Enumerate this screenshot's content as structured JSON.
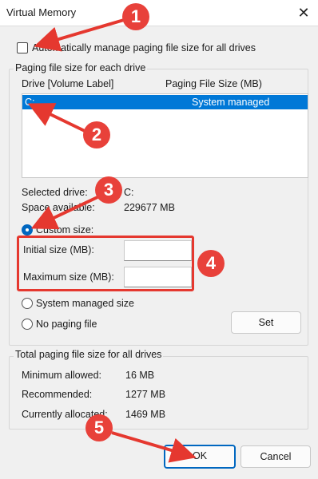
{
  "window": {
    "title": "Virtual Memory"
  },
  "auto_manage": {
    "label": "Automatically manage paging file size for all drives",
    "checked": false
  },
  "each_drive": {
    "group_title": "Paging file size for each drive",
    "col_drive": "Drive  [Volume Label]",
    "col_size": "Paging File Size (MB)",
    "rows": [
      {
        "drive": "C:",
        "size": "System managed"
      }
    ]
  },
  "selected": {
    "drive_label": "Selected drive:",
    "drive_value": "C:",
    "space_label": "Space available:",
    "space_value": "229677 MB"
  },
  "options": {
    "custom": "Custom size:",
    "initial_label": "Initial size (MB):",
    "max_label": "Maximum size (MB):",
    "system_managed": "System managed size",
    "no_paging": "No paging file",
    "set_button": "Set",
    "selected_option": "Custom size:"
  },
  "totals": {
    "group_title": "Total paging file size for all drives",
    "min_label": "Minimum allowed:",
    "min_value": "16 MB",
    "rec_label": "Recommended:",
    "rec_value": "1277 MB",
    "cur_label": "Currently allocated:",
    "cur_value": "1469 MB"
  },
  "buttons": {
    "ok": "OK",
    "cancel": "Cancel"
  },
  "annotations": [
    "1",
    "2",
    "3",
    "4",
    "5"
  ],
  "colors": {
    "accent": "#0078d7",
    "annotation_red": "#e5382f"
  }
}
